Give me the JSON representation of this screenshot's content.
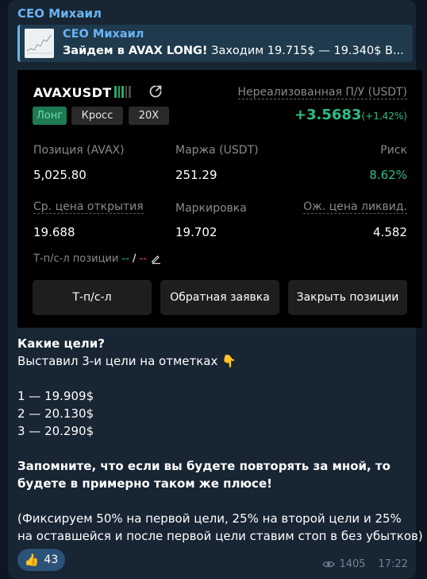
{
  "message": {
    "sender": "CEO Михаил",
    "reply": {
      "name": "CEO Михаил",
      "text_bold": "Зайдем в AVAX LONG!",
      "text_rest": " Заходим 19.715$ — 19.340$ В..."
    },
    "trade_card": {
      "symbol": "AVAXUSDT",
      "tags": [
        "Лонг",
        "Кросс",
        "20X"
      ],
      "unrealized_label": "Нереализованная П/У (USDT)",
      "unrealized_value": "+3.5683",
      "unrealized_pct": "(+1.42%)",
      "position_label": "Позиция (AVAX)",
      "position_value": "5,025.80",
      "margin_label": "Маржа (USDT)",
      "margin_value": "251.29",
      "risk_label": "Риск",
      "risk_value": "8.62%",
      "open_price_label": "Ср. цена открытия",
      "open_price_value": "19.688",
      "mark_label": "Маркировка",
      "mark_value": "19.702",
      "liq_label": "Ож. цена ликвид.",
      "liq_value": "4.582",
      "tpsl_label": "Т-п/с-л позиции",
      "tpsl_tp": "--",
      "tpsl_sep": " / ",
      "tpsl_sl": "--",
      "buttons": [
        "Т-п/с-л",
        "Обратная заявка",
        "Закрыть позиции"
      ]
    },
    "body": {
      "line1": "Какие цели?",
      "line2": "Выставил 3-и цели на отметках 👇",
      "targets": [
        "1 — 19.909$",
        "2 — 20.130$",
        "3 — 20.290$"
      ],
      "note1": "Запомните, что если вы будете повторять за мной, то",
      "note2": "будете в примерно таком же плюсе!",
      "foot1": "(Фиксируем 50% на первой цели, 25% на второй цели и 25%",
      "foot2": "на оставшейся и после первой цели ставим стоп в без убытков)"
    },
    "reaction": {
      "emoji": "👍",
      "count": "43"
    },
    "views": "1405",
    "time": "17:22"
  }
}
